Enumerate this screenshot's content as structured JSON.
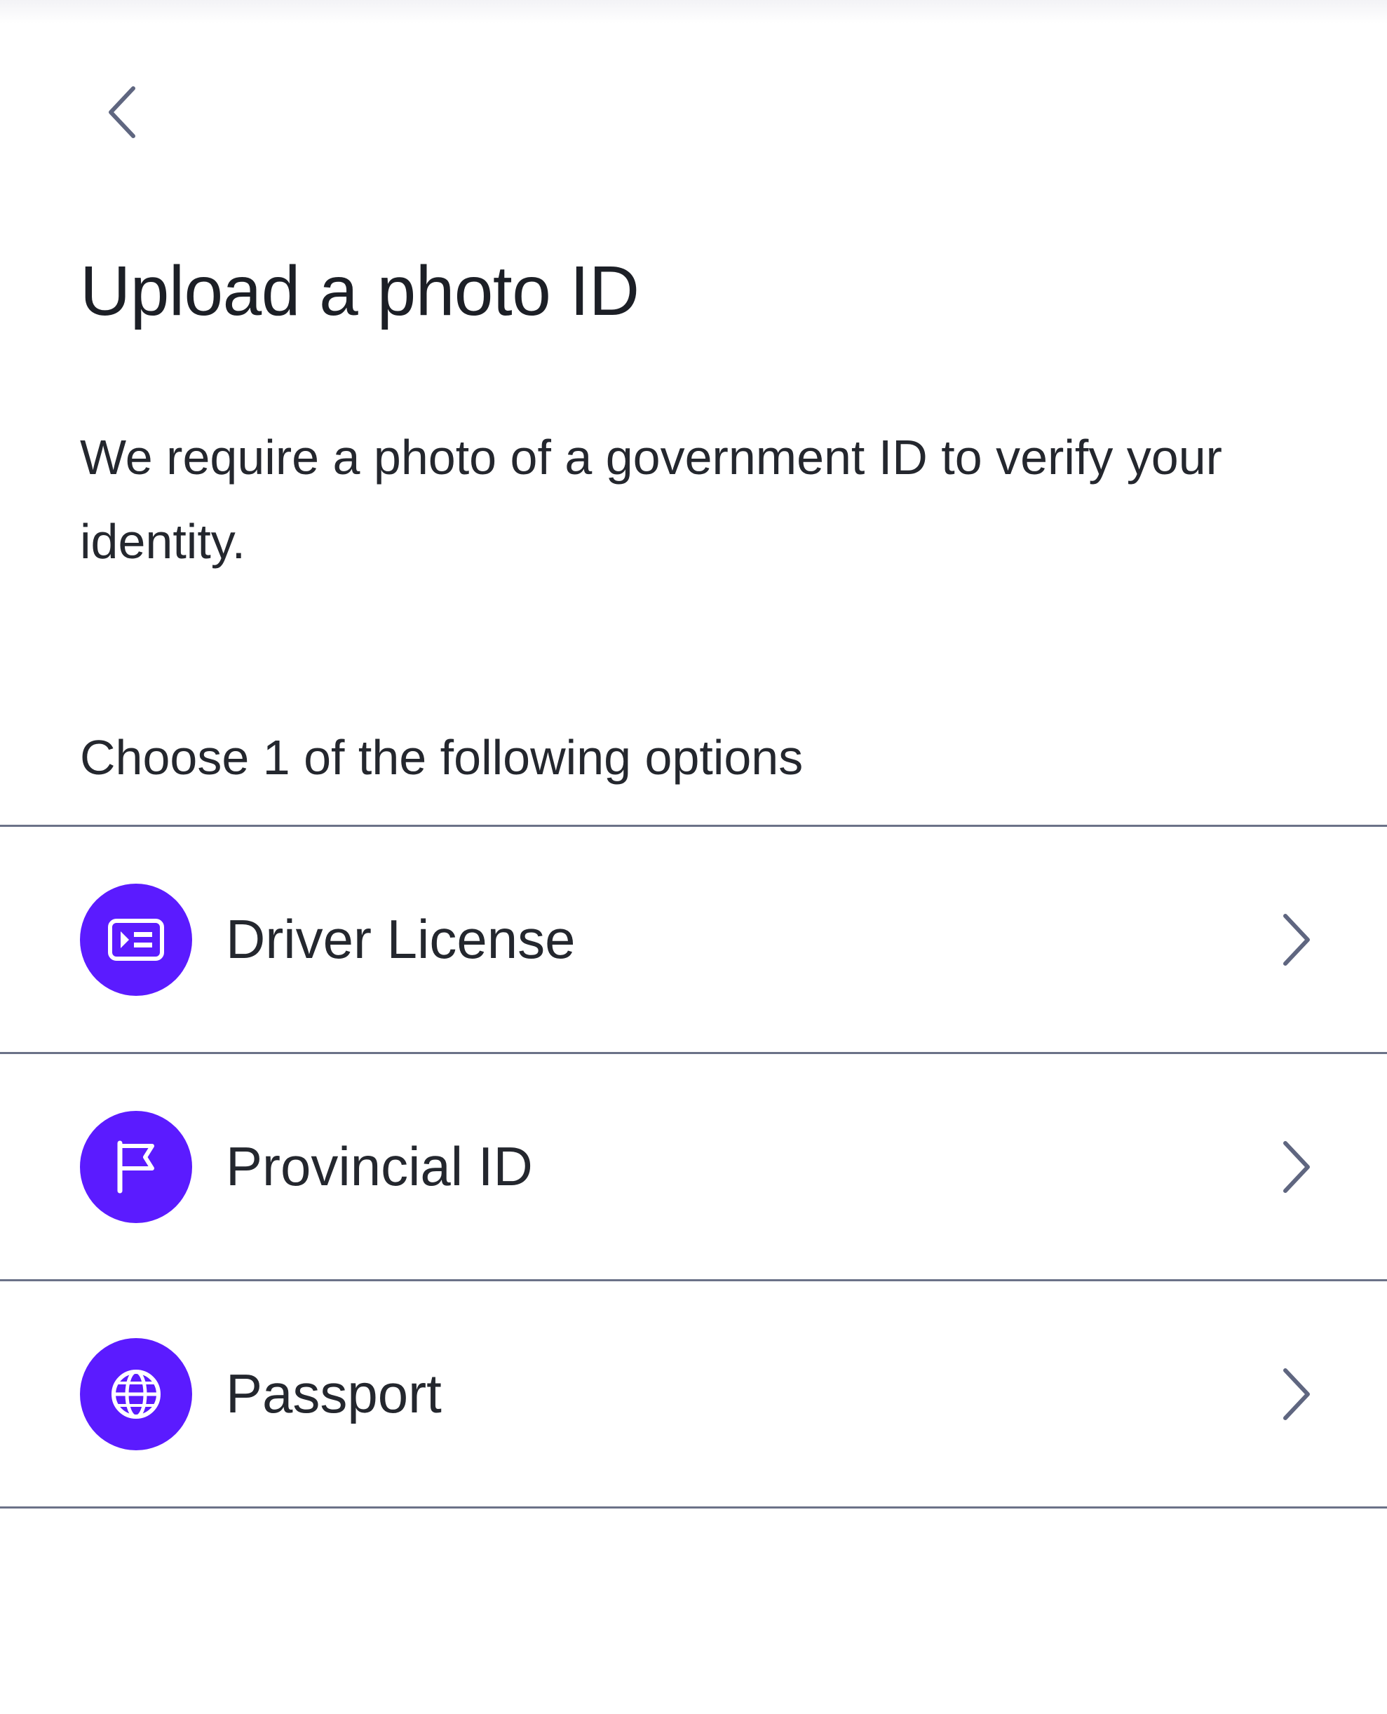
{
  "header": {
    "back_icon": "chevron-left-icon"
  },
  "page": {
    "title": "Upload a photo ID",
    "description": "We require a photo of a government ID to verify your identity.",
    "options_label": "Choose 1 of the following options"
  },
  "options": [
    {
      "label": "Driver License",
      "icon": "id-card-icon"
    },
    {
      "label": "Provincial ID",
      "icon": "flag-icon"
    },
    {
      "label": "Passport",
      "icon": "globe-icon"
    }
  ],
  "colors": {
    "accent": "#5b1bff",
    "divider": "#6b7288",
    "icon_gray": "#5f6680",
    "text": "#1c1f26"
  }
}
